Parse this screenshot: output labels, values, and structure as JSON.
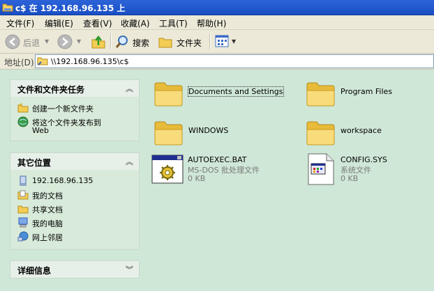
{
  "window": {
    "title": "c$ 在 192.168.96.135 上"
  },
  "menu": [
    "文件(F)",
    "编辑(E)",
    "查看(V)",
    "收藏(A)",
    "工具(T)",
    "帮助(H)"
  ],
  "toolbar": {
    "back": "后退",
    "search": "搜索",
    "folders": "文件夹"
  },
  "address": {
    "label": "地址(D)",
    "value": "\\\\192.168.96.135\\c$"
  },
  "tasks_pane": {
    "title": "文件和文件夹任务",
    "items": [
      "创建一个新文件夹",
      "将这个文件夹发布到",
      "Web"
    ]
  },
  "places_pane": {
    "title": "其它位置",
    "items": [
      "192.168.96.135",
      "我的文档",
      "共享文档",
      "我的电脑",
      "网上邻居"
    ]
  },
  "details_pane": {
    "title": "详细信息"
  },
  "files": [
    {
      "name": "Documents and Settings"
    },
    {
      "name": "Program Files"
    },
    {
      "name": "WINDOWS"
    },
    {
      "name": "workspace"
    },
    {
      "name": "AUTOEXEC.BAT",
      "type": "MS-DOS 批处理文件",
      "size": "0 KB"
    },
    {
      "name": "CONFIG.SYS",
      "type": "系统文件",
      "size": "0 KB"
    }
  ]
}
